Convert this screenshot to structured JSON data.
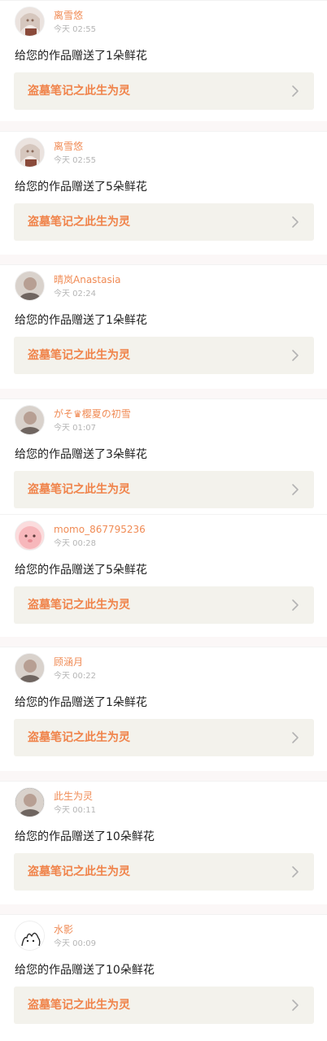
{
  "feed": [
    {
      "avatar_icon": "anime-girl-avatar-icon",
      "user": "离雪悠",
      "time": "今天 02:55",
      "message": "给您的作品赠送了1朵鲜花",
      "work": "盗墓笔记之此生为灵",
      "separator_after": true
    },
    {
      "avatar_icon": "anime-girl-avatar-icon",
      "user": "离雪悠",
      "time": "今天 02:55",
      "message": "给您的作品赠送了5朵鲜花",
      "work": "盗墓笔记之此生为灵",
      "separator_after": true
    },
    {
      "avatar_icon": "photo-avatar-icon",
      "user": "晴岚Anastasia",
      "time": "今天 02:24",
      "message": "给您的作品赠送了1朵鲜花",
      "work": "盗墓笔记之此生为灵",
      "separator_after": true
    },
    {
      "avatar_icon": "photo-avatar-icon",
      "user": "がそ♛樱夏の初雪",
      "time": "今天 01:07",
      "message": "给您的作品赠送了3朵鲜花",
      "work": "盗墓笔记之此生为灵",
      "separator_after": false
    },
    {
      "avatar_icon": "pink-cartoon-avatar-icon",
      "user": "momo_867795236",
      "time": "今天 00:28",
      "message": "给您的作品赠送了5朵鲜花",
      "work": "盗墓笔记之此生为灵",
      "separator_after": true
    },
    {
      "avatar_icon": "photo-avatar-icon",
      "user": "顾涵月",
      "time": "今天 00:22",
      "message": "给您的作品赠送了1朵鲜花",
      "work": "盗墓笔记之此生为灵",
      "separator_after": true
    },
    {
      "avatar_icon": "photo-avatar-icon",
      "user": "此生为灵",
      "time": "今天 00:11",
      "message": "给您的作品赠送了10朵鲜花",
      "work": "盗墓笔记之此生为灵",
      "separator_after": true
    },
    {
      "avatar_icon": "doodle-avatar-icon",
      "user": "水影",
      "time": "今天 00:09",
      "message": "给您的作品赠送了10朵鲜花",
      "work": "盗墓笔记之此生为灵",
      "separator_after": false
    }
  ],
  "colors": {
    "username": "#f08b55",
    "work_title": "#f0834a",
    "work_box_bg": "#f3f2ec",
    "time": "#b5b5b5",
    "separator": "#fbf7f7"
  }
}
